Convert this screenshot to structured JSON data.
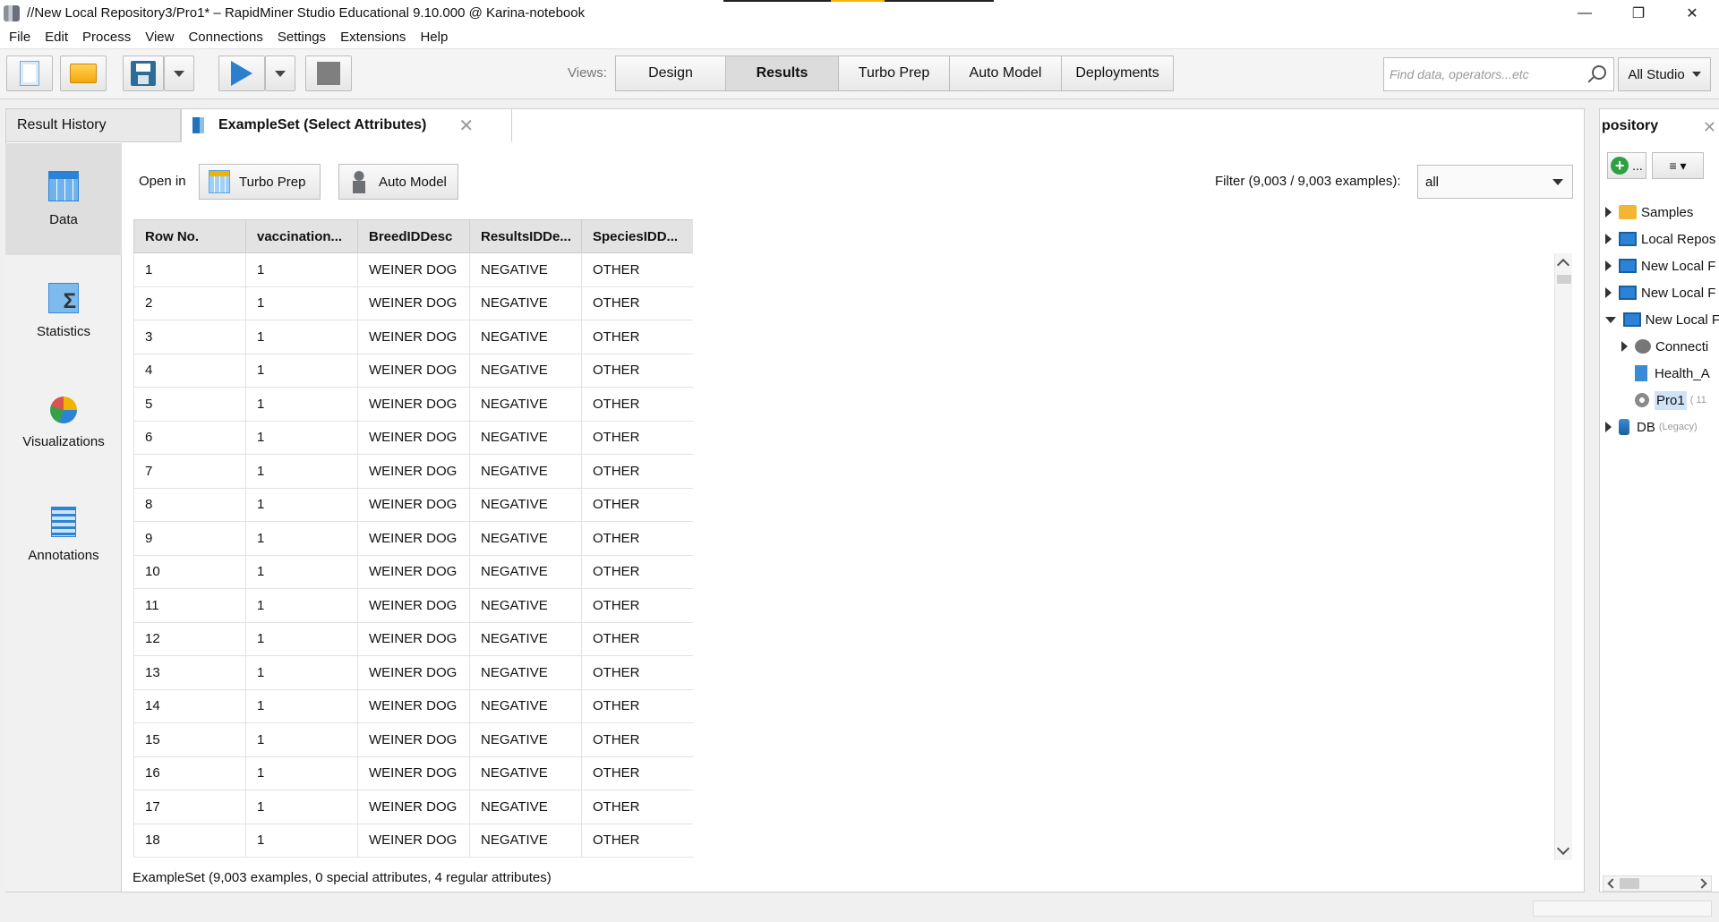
{
  "window": {
    "title": "//New Local Repository3/Pro1* – RapidMiner Studio Educational 9.10.000 @ Karina-notebook",
    "controls": {
      "minimize": "—",
      "maximize": "❐",
      "close": "✕"
    }
  },
  "menu": [
    "File",
    "Edit",
    "Process",
    "View",
    "Connections",
    "Settings",
    "Extensions",
    "Help"
  ],
  "toolbar": {
    "views_label": "Views:",
    "views": [
      {
        "label": "Design",
        "active": false
      },
      {
        "label": "Results",
        "active": true
      },
      {
        "label": "Turbo Prep",
        "active": false
      },
      {
        "label": "Auto Model",
        "active": false
      },
      {
        "label": "Deployments",
        "active": false
      }
    ],
    "search_placeholder": "Find data, operators...etc",
    "search_scope": "All Studio"
  },
  "results": {
    "tabs": [
      {
        "label": "Result History"
      },
      {
        "label": "ExampleSet (Select Attributes)",
        "close": "✕"
      }
    ],
    "nav": [
      {
        "label": "Data",
        "icon": "data-table-icon"
      },
      {
        "label": "Statistics",
        "icon": "statistics-icon"
      },
      {
        "label": "Visualizations",
        "icon": "visualizations-icon"
      },
      {
        "label": "Annotations",
        "icon": "annotations-icon"
      }
    ],
    "open_in_label": "Open in",
    "turbo_prep_label": "Turbo Prep",
    "auto_model_label": "Auto Model",
    "filter_label": "Filter (9,003 / 9,003 examples):",
    "filter_value": "all",
    "table": {
      "columns": [
        "Row No.",
        "vaccination...",
        "BreedIDDesc",
        "ResultsIDDe...",
        "SpeciesIDD..."
      ],
      "rows": [
        [
          "1",
          "1",
          "WEINER DOG",
          "NEGATIVE",
          "OTHER"
        ],
        [
          "2",
          "1",
          "WEINER DOG",
          "NEGATIVE",
          "OTHER"
        ],
        [
          "3",
          "1",
          "WEINER DOG",
          "NEGATIVE",
          "OTHER"
        ],
        [
          "4",
          "1",
          "WEINER DOG",
          "NEGATIVE",
          "OTHER"
        ],
        [
          "5",
          "1",
          "WEINER DOG",
          "NEGATIVE",
          "OTHER"
        ],
        [
          "6",
          "1",
          "WEINER DOG",
          "NEGATIVE",
          "OTHER"
        ],
        [
          "7",
          "1",
          "WEINER DOG",
          "NEGATIVE",
          "OTHER"
        ],
        [
          "8",
          "1",
          "WEINER DOG",
          "NEGATIVE",
          "OTHER"
        ],
        [
          "9",
          "1",
          "WEINER DOG",
          "NEGATIVE",
          "OTHER"
        ],
        [
          "10",
          "1",
          "WEINER DOG",
          "NEGATIVE",
          "OTHER"
        ],
        [
          "11",
          "1",
          "WEINER DOG",
          "NEGATIVE",
          "OTHER"
        ],
        [
          "12",
          "1",
          "WEINER DOG",
          "NEGATIVE",
          "OTHER"
        ],
        [
          "13",
          "1",
          "WEINER DOG",
          "NEGATIVE",
          "OTHER"
        ],
        [
          "14",
          "1",
          "WEINER DOG",
          "NEGATIVE",
          "OTHER"
        ],
        [
          "15",
          "1",
          "WEINER DOG",
          "NEGATIVE",
          "OTHER"
        ],
        [
          "16",
          "1",
          "WEINER DOG",
          "NEGATIVE",
          "OTHER"
        ],
        [
          "17",
          "1",
          "WEINER DOG",
          "NEGATIVE",
          "OTHER"
        ],
        [
          "18",
          "1",
          "WEINER DOG",
          "NEGATIVE",
          "OTHER"
        ]
      ]
    },
    "status": "ExampleSet (9,003 examples, 0 special attributes, 4 regular attributes)"
  },
  "repository": {
    "title": "pository",
    "close": "✕",
    "add_label": "...",
    "menu_label": "≡ ▾",
    "tree": [
      {
        "label": "Samples",
        "icon": "folder-icon",
        "expanded": false,
        "indent": 0
      },
      {
        "label": "Local Repos",
        "icon": "monitor-icon",
        "expanded": false,
        "indent": 0
      },
      {
        "label": "New Local F",
        "icon": "monitor-icon",
        "expanded": false,
        "indent": 0
      },
      {
        "label": "New Local F",
        "icon": "monitor-icon",
        "expanded": false,
        "indent": 0
      },
      {
        "label": "New Local F",
        "icon": "monitor-icon",
        "expanded": true,
        "indent": 0
      },
      {
        "label": "Connecti",
        "icon": "connection-icon",
        "expanded": false,
        "indent": 1
      },
      {
        "label": "Health_A",
        "icon": "data-file-icon",
        "expanded": null,
        "indent": 1
      },
      {
        "label": "Pro1",
        "meta": "( 11",
        "icon": "process-gear-icon",
        "expanded": null,
        "indent": 1,
        "selected": true
      },
      {
        "label": "DB",
        "meta": "(Legacy)",
        "icon": "database-icon",
        "expanded": false,
        "indent": 0
      }
    ]
  }
}
